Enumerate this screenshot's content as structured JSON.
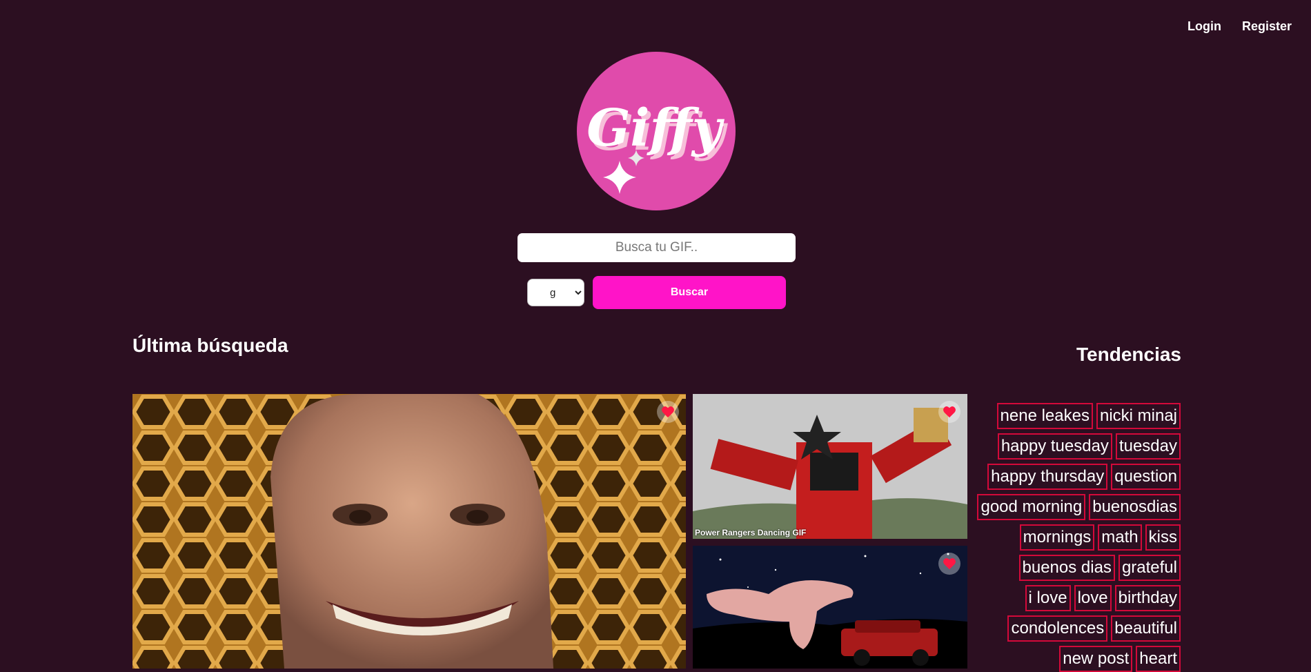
{
  "nav": {
    "login_label": "Login",
    "register_label": "Register"
  },
  "logo": {
    "text": "Giffy",
    "circle_color": "#e04bab"
  },
  "search": {
    "placeholder": "Busca tu GIF..",
    "value": "",
    "rating_selected": "g",
    "button_label": "Buscar"
  },
  "last_search": {
    "title": "Última búsqueda",
    "gifs": [
      {
        "title": "",
        "subject": "smiling bald face on honeycomb"
      },
      {
        "title": "Power Rangers Dancing GIF",
        "subject": "red robot dancing"
      },
      {
        "title": "",
        "subject": "dinosaur nugget over car at night"
      }
    ]
  },
  "trends": {
    "title": "Tendencias",
    "items": [
      "nene leakes",
      "nicki minaj",
      "happy tuesday",
      "tuesday",
      "happy thursday",
      "question",
      "good morning",
      "buenosdias",
      "mornings",
      "math",
      "kiss",
      "buenos dias",
      "grateful",
      "i love",
      "love",
      "birthday",
      "condolences",
      "beautiful",
      "new post",
      "heart"
    ]
  },
  "colors": {
    "background": "#2c0f21",
    "accent": "#ff14c8",
    "tag_border": "#d4093a",
    "heart": "#ff1744"
  }
}
